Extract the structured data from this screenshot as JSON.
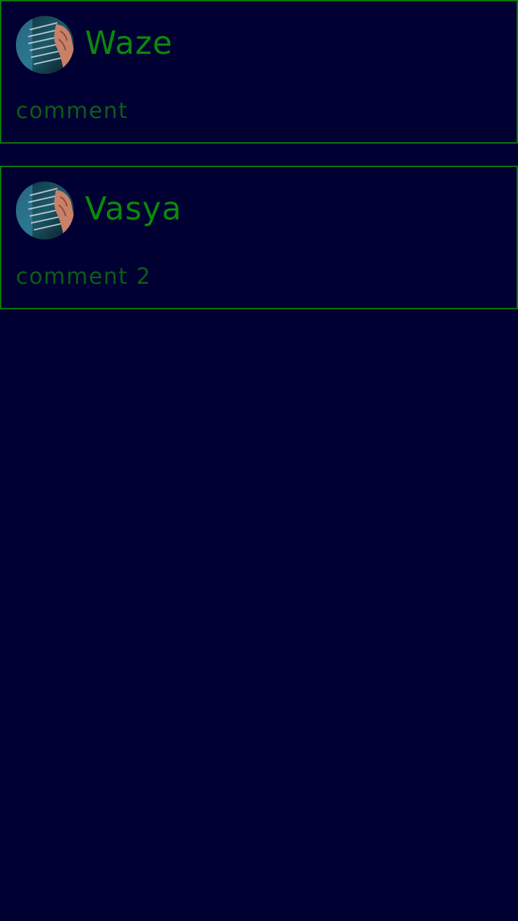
{
  "colors": {
    "background": "#000033",
    "card_border": "#0a7a0a",
    "author_text": "#0a8a0a",
    "comment_text": "#0c5c16"
  },
  "comments": [
    {
      "author": "Waze",
      "text": "comment",
      "avatar_icon": "keyboard-hands-avatar"
    },
    {
      "author": "Vasya",
      "text": "comment 2",
      "avatar_icon": "keyboard-hands-avatar"
    }
  ]
}
